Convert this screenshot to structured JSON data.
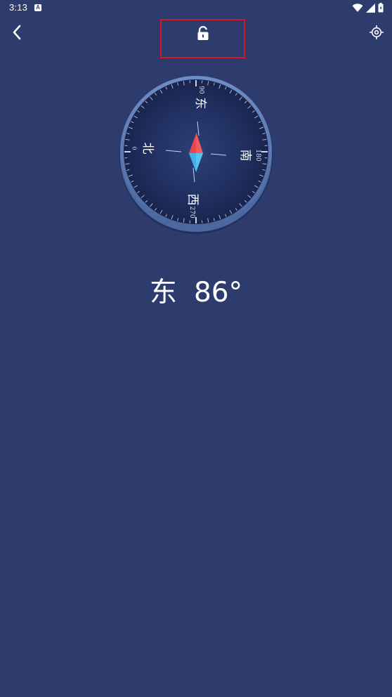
{
  "status_bar": {
    "time": "3:13",
    "notification_label": "A",
    "icons": [
      "wifi-icon",
      "signal-icon",
      "battery-icon"
    ]
  },
  "toolbar": {
    "back_icon": "chevron-left-icon",
    "lock_icon": "unlocked-padlock-icon",
    "locate_icon": "crosshair-target-icon",
    "highlight_color": "#d8161f"
  },
  "compass": {
    "directions": {
      "north": "北",
      "east": "东",
      "south": "南",
      "west": "西"
    },
    "degree_labels": {
      "north": "0",
      "east": "90",
      "south": "180",
      "west": "270"
    },
    "needle_colors": {
      "north_tip": "#e8474f",
      "south_tip": "#3fb3e8"
    },
    "heading_degrees": 86
  },
  "readout": {
    "direction": "东",
    "degrees": "86°"
  },
  "colors": {
    "background": "#2d3c6d",
    "dial_face": "#1f2e5a",
    "dial_rim": "#5c7cb6"
  }
}
